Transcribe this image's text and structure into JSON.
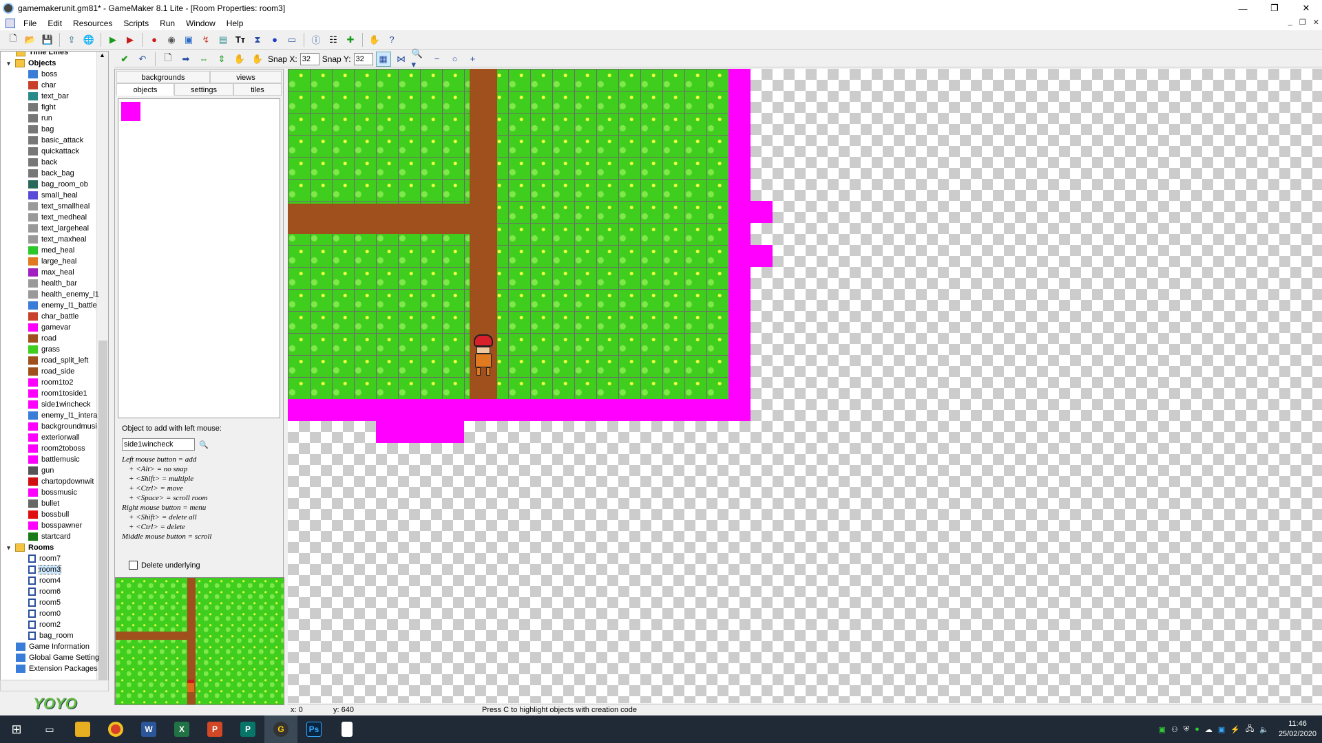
{
  "window": {
    "title": "gamemakerunit.gm81* - GameMaker 8.1 Lite - [Room Properties: room3]",
    "controls": [
      "—",
      "❐",
      "✕"
    ]
  },
  "menu": [
    "File",
    "Edit",
    "Resources",
    "Scripts",
    "Run",
    "Window",
    "Help"
  ],
  "tree": {
    "top_folder": "Time Lines",
    "objects_folder": "Objects",
    "objects": [
      {
        "name": "boss",
        "color": "#3a7dd8"
      },
      {
        "name": "char",
        "color": "#c8402a"
      },
      {
        "name": "text_bar",
        "color": "#2a8a8a"
      },
      {
        "name": "fight",
        "color": "#777777"
      },
      {
        "name": "run",
        "color": "#777777"
      },
      {
        "name": "bag",
        "color": "#777777"
      },
      {
        "name": "basic_attack",
        "color": "#777777"
      },
      {
        "name": "quickattack",
        "color": "#777777"
      },
      {
        "name": "back",
        "color": "#777777"
      },
      {
        "name": "back_bag",
        "color": "#777777"
      },
      {
        "name": "bag_room_ob",
        "color": "#2a6a5a"
      },
      {
        "name": "small_heal",
        "color": "#5a4ad8"
      },
      {
        "name": "text_smallheal",
        "color": "#999999"
      },
      {
        "name": "text_medheal",
        "color": "#999999"
      },
      {
        "name": "text_largeheal",
        "color": "#999999"
      },
      {
        "name": "text_maxheal",
        "color": "#999999"
      },
      {
        "name": "med_heal",
        "color": "#2ac82a"
      },
      {
        "name": "large_heal",
        "color": "#e07a20"
      },
      {
        "name": "max_heal",
        "color": "#a020c0"
      },
      {
        "name": "health_bar",
        "color": "#999999"
      },
      {
        "name": "health_enemy_l1",
        "color": "#999999"
      },
      {
        "name": "enemy_l1_battle",
        "color": "#3a7dd8"
      },
      {
        "name": "char_battle",
        "color": "#c8402a"
      },
      {
        "name": "gamevar",
        "color": "#ff00ff"
      },
      {
        "name": "road",
        "color": "#a0501c"
      },
      {
        "name": "grass",
        "color": "#3fce1e"
      },
      {
        "name": "road_split_left",
        "color": "#a0501c"
      },
      {
        "name": "road_side",
        "color": "#a0501c"
      },
      {
        "name": "room1to2",
        "color": "#ff00ff"
      },
      {
        "name": "room1toside1",
        "color": "#ff00ff"
      },
      {
        "name": "side1wincheck",
        "color": "#ff00ff"
      },
      {
        "name": "enemy_l1_intera",
        "color": "#3a7dd8"
      },
      {
        "name": "backgroundmusi",
        "color": "#ff00ff"
      },
      {
        "name": "exteriorwall",
        "color": "#ff00ff"
      },
      {
        "name": "room2toboss",
        "color": "#ff00ff"
      },
      {
        "name": "battlemusic",
        "color": "#ff00ff"
      },
      {
        "name": "gun",
        "color": "#555555"
      },
      {
        "name": "chartopdownwit",
        "color": "#d01010"
      },
      {
        "name": "bossmusic",
        "color": "#ff00ff"
      },
      {
        "name": "bullet",
        "color": "#666666"
      },
      {
        "name": "bossbull",
        "color": "#e01010"
      },
      {
        "name": "bosspawner",
        "color": "#ff00ff"
      },
      {
        "name": "startcard",
        "color": "#1a7a1a"
      }
    ],
    "rooms_folder": "Rooms",
    "rooms": [
      "room7",
      "room3",
      "room4",
      "room6",
      "room5",
      "room0",
      "room2",
      "bag_room"
    ],
    "selected_room": "room3",
    "bottom_items": [
      "Game Information",
      "Global Game Setting",
      "Extension Packages"
    ]
  },
  "logo_text": "YOYO GAMES",
  "room_toolbar": {
    "snap_x_label": "Snap X:",
    "snap_x": "32",
    "snap_y_label": "Snap Y:",
    "snap_y": "32"
  },
  "tabs": {
    "row1": [
      "backgrounds",
      "views"
    ],
    "row2": [
      "objects",
      "settings",
      "tiles"
    ],
    "active": "objects"
  },
  "object_panel": {
    "label": "Object to add with left mouse:",
    "selected_object": "side1wincheck",
    "help": [
      "Left mouse button = add",
      "+ <Alt> = no snap",
      "+ <Shift> = multiple",
      "+ <Ctrl> = move",
      "+ <Space> = scroll room",
      "Right mouse button = menu",
      "+ <Shift> = delete all",
      "+ <Ctrl> = delete",
      "Middle mouse button = scroll"
    ],
    "delete_underlying": "Delete underlying"
  },
  "status": {
    "x": "x: 0",
    "y": "y: 640",
    "hint": "Press C to highlight objects with creation code"
  },
  "taskbar": {
    "time": "11:46",
    "date": "25/02/2020"
  },
  "colors": {
    "grass": "#3fce1e",
    "road": "#a0501c",
    "wall": "#ff00ff"
  }
}
